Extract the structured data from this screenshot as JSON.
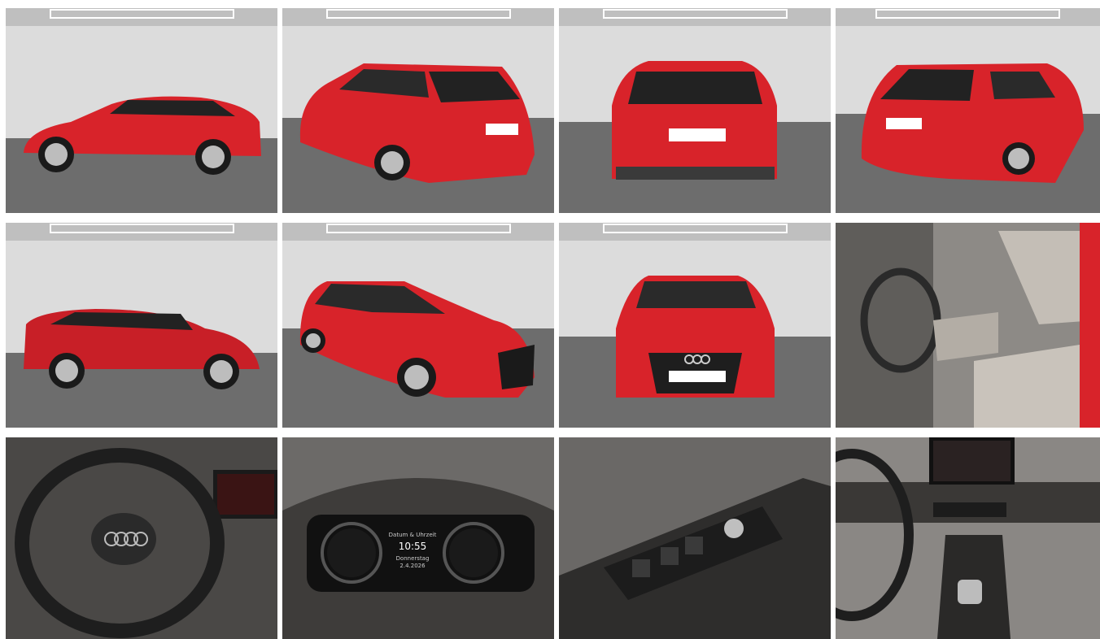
{
  "gallery": {
    "photos": [
      {
        "subject": "exterior-side-left",
        "view": "studio"
      },
      {
        "subject": "exterior-rear-three-quarter-left",
        "view": "studio"
      },
      {
        "subject": "exterior-rear",
        "view": "studio"
      },
      {
        "subject": "exterior-rear-three-quarter-right",
        "view": "studio"
      },
      {
        "subject": "exterior-side-right",
        "view": "studio"
      },
      {
        "subject": "exterior-front-three-quarter",
        "view": "studio"
      },
      {
        "subject": "exterior-front",
        "view": "studio"
      },
      {
        "subject": "interior-front-seats",
        "view": "interior"
      },
      {
        "subject": "interior-steering-wheel",
        "view": "interior"
      },
      {
        "subject": "interior-instrument-cluster",
        "view": "interior"
      },
      {
        "subject": "interior-window-controls",
        "view": "interior"
      },
      {
        "subject": "interior-dashboard-center",
        "view": "interior"
      }
    ],
    "cluster": {
      "time": "10:55",
      "line1": "Datum & Uhrzeit",
      "line2": "Donnerstag",
      "line3": "2.4.2026"
    }
  },
  "colors": {
    "car_red": "#d8232a",
    "studio_wall": "#d9d9d9",
    "studio_floor": "#6e6e6e",
    "interior_grey": "#8d8a86"
  }
}
